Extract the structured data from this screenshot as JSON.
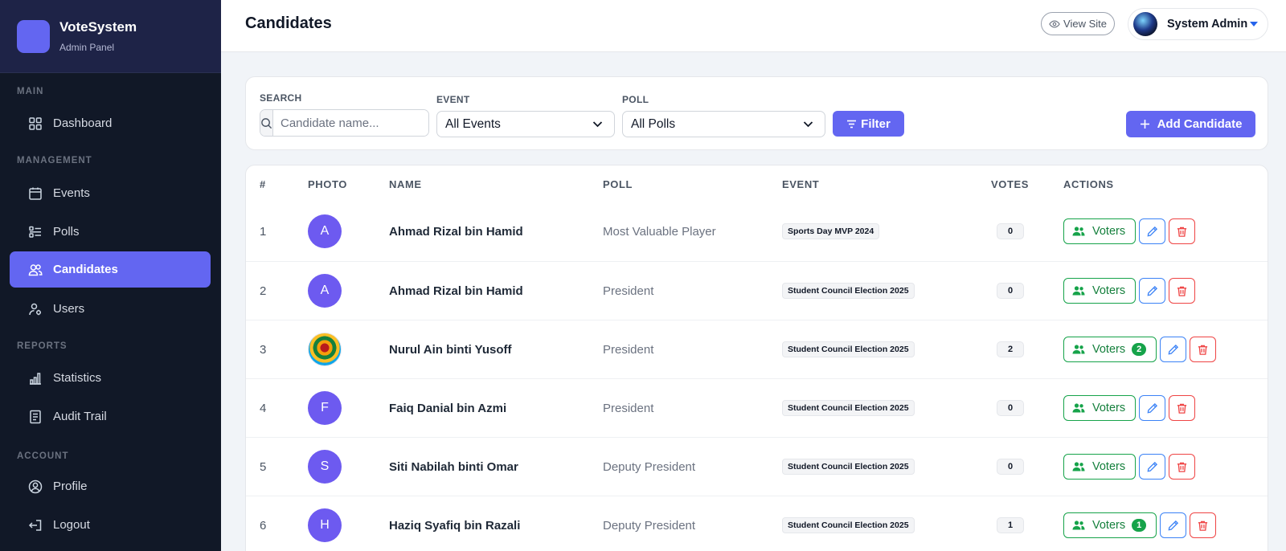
{
  "brand": {
    "name": "VoteSystem",
    "subtitle": "Admin Panel"
  },
  "sidebar": {
    "sections": {
      "main": "MAIN",
      "management": "MANAGEMENT",
      "reports": "REPORTS",
      "account": "ACCOUNT"
    },
    "items": [
      {
        "label": "Dashboard",
        "icon": "grid-icon"
      },
      {
        "label": "Events",
        "icon": "calendar-icon"
      },
      {
        "label": "Polls",
        "icon": "list-icon"
      },
      {
        "label": "Candidates",
        "icon": "users-icon",
        "active": true
      },
      {
        "label": "Users",
        "icon": "user-cog-icon"
      },
      {
        "label": "Statistics",
        "icon": "bar-chart-icon"
      },
      {
        "label": "Audit Trail",
        "icon": "document-icon"
      },
      {
        "label": "Profile",
        "icon": "user-circle-icon"
      },
      {
        "label": "Logout",
        "icon": "logout-icon"
      }
    ]
  },
  "header": {
    "title": "Candidates",
    "view_site": "View Site",
    "user_name": "System Admin"
  },
  "filters": {
    "search_label": "SEARCH",
    "search_placeholder": "Candidate name...",
    "event_label": "EVENT",
    "event_value": "All Events",
    "poll_label": "POLL",
    "poll_value": "All Polls",
    "filter_button": "Filter",
    "add_button": "Add Candidate"
  },
  "table": {
    "headers": {
      "num": "#",
      "photo": "PHOTO",
      "name": "NAME",
      "poll": "POLL",
      "event": "EVENT",
      "votes": "VOTES",
      "actions": "ACTIONS"
    },
    "voters_label": "Voters",
    "rows": [
      {
        "num": "1",
        "initial": "A",
        "name": "Ahmad Rizal bin Hamid",
        "poll": "Most Valuable Player",
        "event": "Sports Day MVP 2024",
        "votes": "0",
        "voter_count": ""
      },
      {
        "num": "2",
        "initial": "A",
        "name": "Ahmad Rizal bin Hamid",
        "poll": "President",
        "event": "Student Council Election 2025",
        "votes": "0",
        "voter_count": ""
      },
      {
        "num": "3",
        "initial": "",
        "name": "Nurul Ain binti Yusoff",
        "poll": "President",
        "event": "Student Council Election 2025",
        "votes": "2",
        "voter_count": "2"
      },
      {
        "num": "4",
        "initial": "F",
        "name": "Faiq Danial bin Azmi",
        "poll": "President",
        "event": "Student Council Election 2025",
        "votes": "0",
        "voter_count": ""
      },
      {
        "num": "5",
        "initial": "S",
        "name": "Siti Nabilah binti Omar",
        "poll": "Deputy President",
        "event": "Student Council Election 2025",
        "votes": "0",
        "voter_count": ""
      },
      {
        "num": "6",
        "initial": "H",
        "name": "Haziq Syafiq bin Razali",
        "poll": "Deputy President",
        "event": "Student Council Election 2025",
        "votes": "1",
        "voter_count": "1"
      }
    ]
  },
  "colors": {
    "accent": "#6366f1",
    "sidebar_bg": "#111827",
    "success": "#16a34a",
    "danger": "#ef4444",
    "info": "#3b82f6"
  }
}
